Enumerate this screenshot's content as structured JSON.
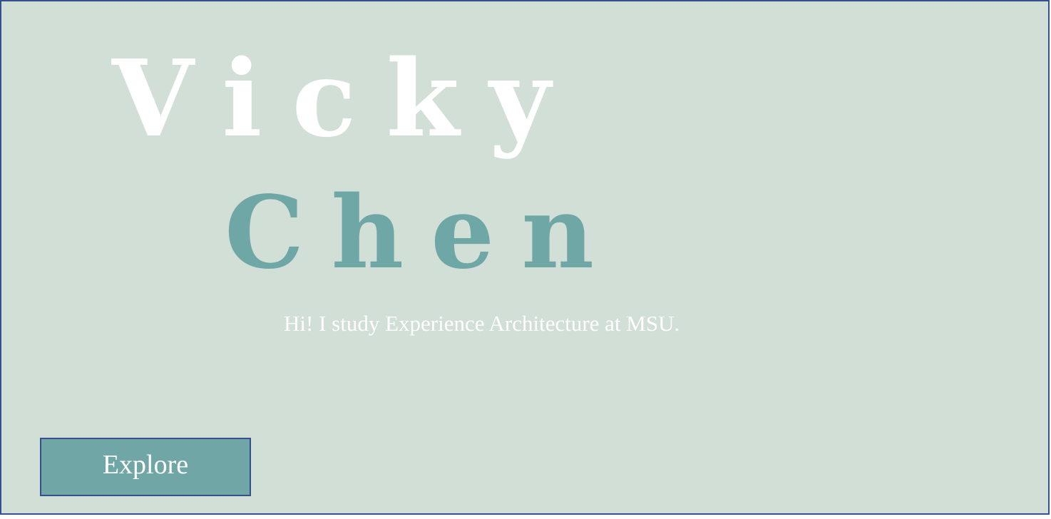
{
  "hero": {
    "first_name": "Vicky",
    "last_name": "Chen",
    "tagline": "Hi! I study Experience Architecture at MSU.",
    "explore_label": "Explore"
  },
  "colors": {
    "background": "#d1dfd7",
    "accent": "#70a7a6",
    "border": "#36508f",
    "text_light": "#ffffff"
  }
}
